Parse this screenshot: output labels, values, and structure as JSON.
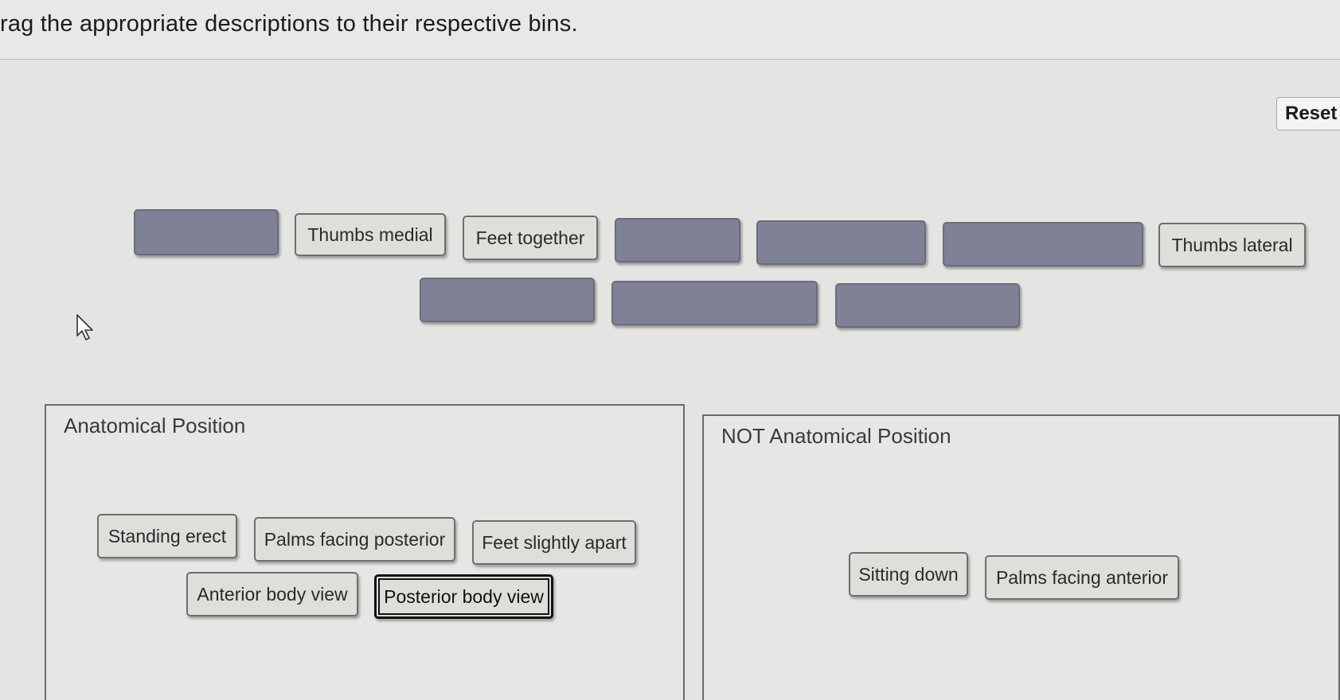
{
  "instruction": "rag the appropriate descriptions to their respective bins.",
  "reset_label": "Reset",
  "pool": {
    "labels": [
      "Thumbs medial",
      "Feet together",
      "Thumbs lateral"
    ]
  },
  "bins": {
    "anatomical": {
      "title": "Anatomical Position",
      "items": [
        "Standing erect",
        "Palms facing posterior",
        "Feet slightly apart",
        "Anterior body view",
        "Posterior body view"
      ]
    },
    "not_anatomical": {
      "title": "NOT Anatomical Position",
      "items": [
        "Sitting down",
        "Palms facing anterior"
      ]
    }
  },
  "icons": {
    "cursor": "arrow-cursor-icon"
  },
  "colors": {
    "empty_slot": "#7f8296",
    "chip_bg": "#dededb",
    "background": "#e4e4e2"
  }
}
